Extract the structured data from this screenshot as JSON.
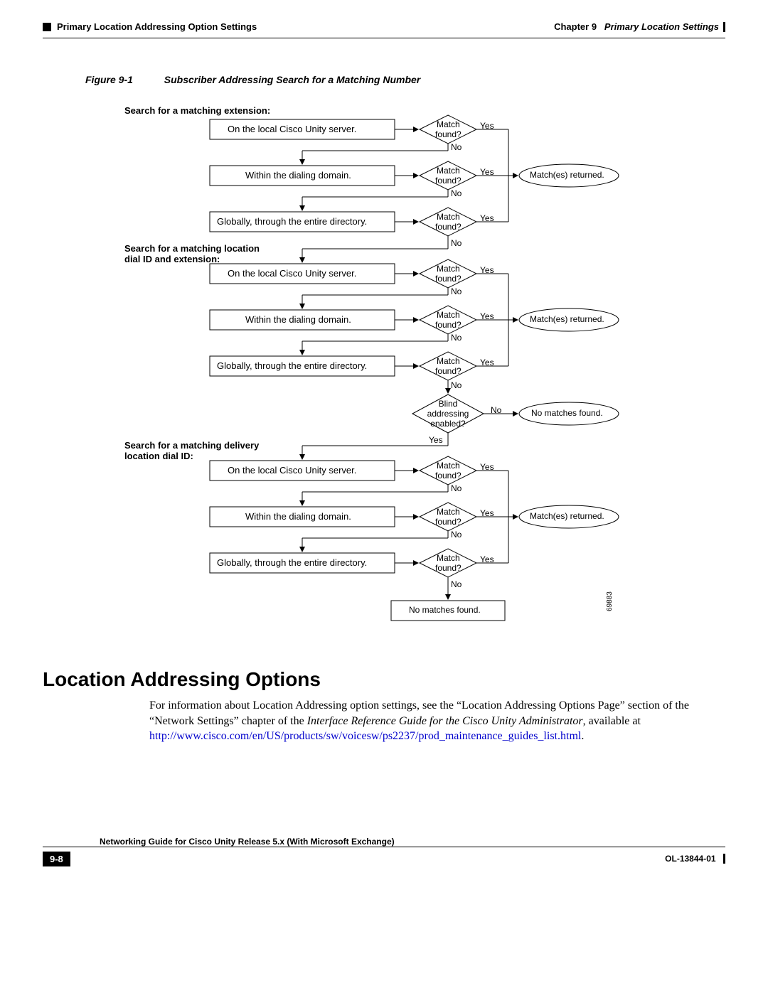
{
  "header": {
    "section": "Primary Location Addressing Option Settings",
    "chapter_label": "Chapter 9",
    "chapter_title": "Primary Location Settings"
  },
  "figure": {
    "number": "Figure 9-1",
    "title": "Subscriber Addressing Search for a Matching Number"
  },
  "diagram": {
    "section1_title": "Search for a matching extension:",
    "section2_title_l1": "Search for a matching location",
    "section2_title_l2": "dial ID and extension:",
    "section3_title_l1": "Search for a matching delivery",
    "section3_title_l2": "location dial ID:",
    "box_local": "On the local Cisco Unity server.",
    "box_domain": "Within the dialing domain.",
    "box_global": "Globally, through the entire directory.",
    "decision_match_l1": "Match",
    "decision_match_l2": "found?",
    "decision_blind_l1": "Blind",
    "decision_blind_l2": "addressing",
    "decision_blind_l3": "enabled?",
    "yes": "Yes",
    "no": "No",
    "result_match": "Match(es) returned.",
    "result_nomatch": "No matches found.",
    "refnum": "69883"
  },
  "section_heading": "Location Addressing Options",
  "body": {
    "p1a": "For information about Location Addressing option settings, see the “Location Addressing Options Page” section of the “Network Settings” chapter of the ",
    "p1b_italic": "Interface Reference Guide for the Cisco Unity Administrator",
    "p1c": ", available at ",
    "link": "http://www.cisco.com/en/US/products/sw/voicesw/ps2237/prod_maintenance_guides_list.html",
    "p1d": "."
  },
  "footer": {
    "guide_title": "Networking Guide for Cisco Unity Release 5.x (With Microsoft Exchange)",
    "page_number": "9-8",
    "doc_number": "OL-13844-01"
  }
}
